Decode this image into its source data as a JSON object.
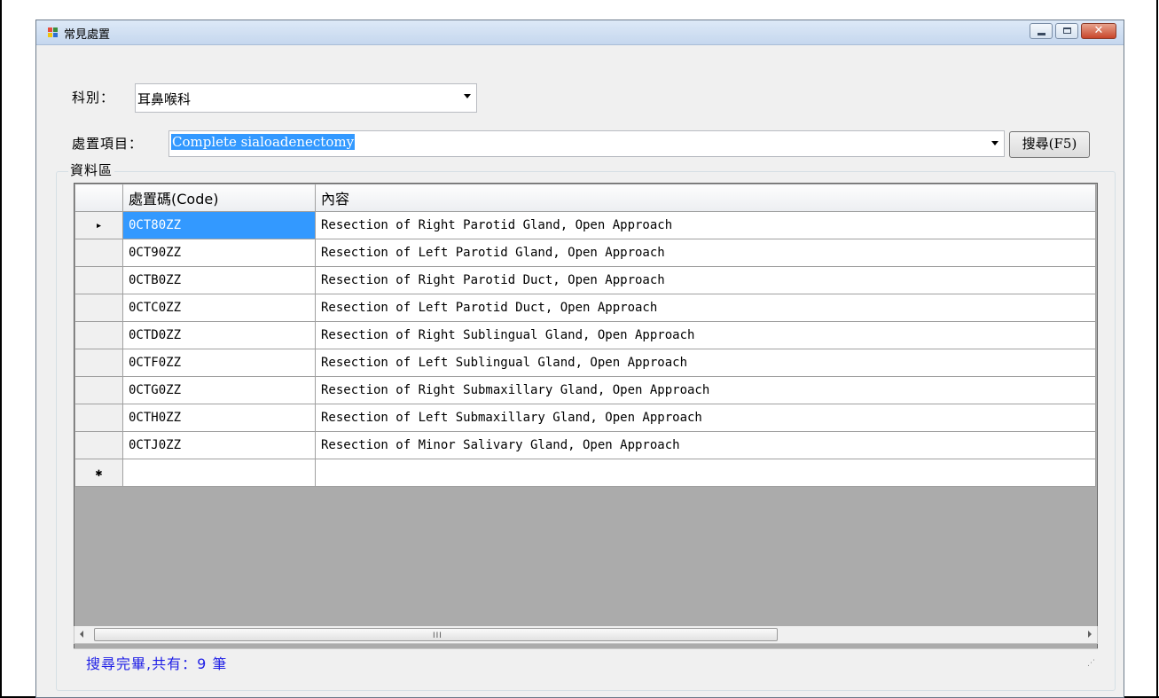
{
  "window": {
    "title": "常見處置",
    "close_glyph": "✕"
  },
  "form": {
    "department_label": "科別：",
    "department_value": "耳鼻喉科",
    "procedure_label": "處置項目：",
    "procedure_value": "Complete sialoadenectomy",
    "search_button": "搜尋(F5)"
  },
  "data_area": {
    "group_label": "資料區",
    "columns": [
      "處置碼(Code)",
      "內容"
    ],
    "current_row_glyph": "▸",
    "new_row_glyph": "✱",
    "rows": [
      {
        "code": "0CT80ZZ",
        "content": "Resection of Right Parotid Gland, Open Approach"
      },
      {
        "code": "0CT90ZZ",
        "content": "Resection of Left Parotid Gland, Open Approach"
      },
      {
        "code": "0CTB0ZZ",
        "content": "Resection of Right Parotid Duct, Open Approach"
      },
      {
        "code": "0CTC0ZZ",
        "content": "Resection of Left Parotid Duct, Open Approach"
      },
      {
        "code": "0CTD0ZZ",
        "content": "Resection of Right Sublingual Gland, Open Approach"
      },
      {
        "code": "0CTF0ZZ",
        "content": "Resection of Left Sublingual Gland, Open Approach"
      },
      {
        "code": "0CTG0ZZ",
        "content": "Resection of Right Submaxillary Gland, Open Approach"
      },
      {
        "code": "0CTH0ZZ",
        "content": "Resection of Left Submaxillary Gland, Open Approach"
      },
      {
        "code": "0CTJ0ZZ",
        "content": "Resection of Minor Salivary Gland, Open Approach"
      }
    ]
  },
  "status": {
    "text": "搜尋完畢,共有：9 筆",
    "grip": "⋰"
  },
  "scrollbar": {
    "grip": "III"
  },
  "colors": {
    "selection": "#3399ff",
    "status_text": "#1f1fe6",
    "grid_empty": "#ababab"
  }
}
